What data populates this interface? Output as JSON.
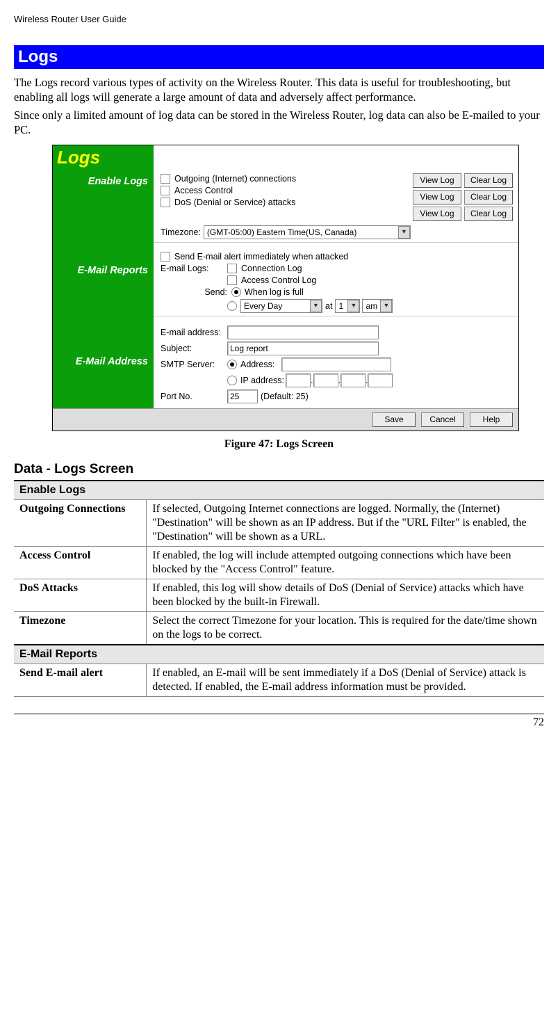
{
  "header": "Wireless Router User Guide",
  "banner_title": "Logs",
  "intro_p1": "The Logs record various types of activity on the Wireless Router. This data is useful for troubleshooting, but enabling all logs will generate a large amount of data and adversely affect performance.",
  "intro_p2": "Since only a limited amount of log data can be stored in the Wireless Router, log data can also be E-mailed to your PC.",
  "figure_caption": "Figure 47: Logs Screen",
  "data_heading": "Data - Logs Screen",
  "screenshot": {
    "title": "Logs",
    "nav": {
      "enable": "Enable Logs",
      "email_reports": "E-Mail Reports",
      "email_address": "E-Mail Address"
    },
    "enable": {
      "outgoing": "Outgoing (Internet) connections",
      "access": "Access Control",
      "dos": "DoS (Denial or Service) attacks",
      "view_log": "View Log",
      "clear_log": "Clear Log",
      "timezone_label": "Timezone:",
      "timezone_value": "(GMT-05:00) Eastern Time(US, Canada)"
    },
    "email_reports": {
      "alert": "Send E-mail alert immediately when attacked",
      "email_logs_label": "E-mail Logs:",
      "conn_log": "Connection Log",
      "access_log": "Access Control Log",
      "send_label": "Send:",
      "when_full": "When log is full",
      "every_day": "Every Day",
      "at": "at",
      "hour": "1",
      "ampm": "am"
    },
    "email_address": {
      "email_label": "E-mail address:",
      "subject_label": "Subject:",
      "subject_value": "Log report",
      "smtp_label": "SMTP Server:",
      "address_label": "Address:",
      "ip_label": "IP address:",
      "port_label": "Port No.",
      "port_value": "25",
      "port_default": "(Default: 25)"
    },
    "buttons": {
      "save": "Save",
      "cancel": "Cancel",
      "help": "Help"
    }
  },
  "table": {
    "section1": "Enable Logs",
    "row1": {
      "left": "Outgoing Connections",
      "right": "If selected, Outgoing Internet connections are logged. Normally, the (Internet) \"Destination\" will be shown as an IP address. But if the \"URL Filter\" is enabled, the \"Destination\" will be shown as a URL."
    },
    "row2": {
      "left": "Access Control",
      "right": "If enabled, the log will include attempted outgoing connections which have been blocked by the \"Access Control\" feature."
    },
    "row3": {
      "left": "DoS Attacks",
      "right": "If enabled, this log will show details of DoS (Denial of Service) attacks which have been blocked by the built-in Firewall."
    },
    "row4": {
      "left": "Timezone",
      "right": "Select the correct Timezone for your location. This is required for the date/time shown on the logs to be correct."
    },
    "section2": "E-Mail Reports",
    "row5": {
      "left": "Send E-mail alert",
      "right": "If enabled, an E-mail will be sent immediately if a DoS (Denial of Service) attack is detected. If enabled, the E-mail address information must be provided."
    }
  },
  "page_number": "72"
}
